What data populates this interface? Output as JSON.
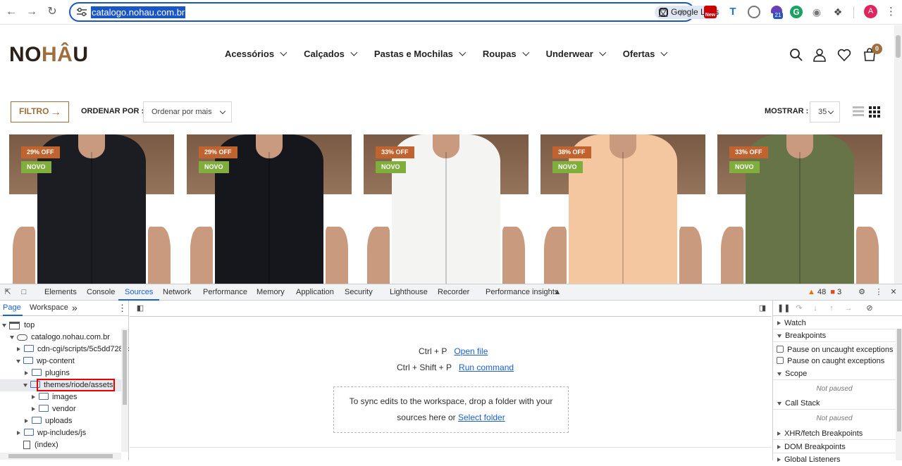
{
  "browser": {
    "url": "catalogo.nohau.com.br",
    "lens_label": "Google Lens",
    "ext_new_label": "New",
    "ext_21_label": "21",
    "avatar_letter": "A"
  },
  "site": {
    "logo_left": "NO",
    "logo_accent": "HÂ",
    "logo_right": "U",
    "menu": [
      {
        "label": "Acessórios"
      },
      {
        "label": "Calçados"
      },
      {
        "label": "Pastas e Mochilas"
      },
      {
        "label": "Roupas"
      },
      {
        "label": "Underwear"
      },
      {
        "label": "Ofertas"
      }
    ],
    "cart_count": "0"
  },
  "filters": {
    "filter_label": "FILTRO",
    "filter_arrow": "→",
    "order_label": "ORDENAR POR :",
    "order_value": "Ordenar por mais",
    "show_label": "MOSTRAR :",
    "show_value": "35"
  },
  "products": [
    {
      "discount": "29% OFF",
      "tag": "NOVO",
      "color": "#1b1d23"
    },
    {
      "discount": "29% OFF",
      "tag": "NOVO",
      "color": "#15171c"
    },
    {
      "discount": "33% OFF",
      "tag": "NOVO",
      "color": "#f4f4f2"
    },
    {
      "discount": "38% OFF",
      "tag": "NOVO",
      "color": "#f5c7a0"
    },
    {
      "discount": "33% OFF",
      "tag": "NOVO",
      "color": "#667448"
    }
  ],
  "devtools": {
    "tabs": [
      {
        "label": "Elements"
      },
      {
        "label": "Console"
      },
      {
        "label": "Sources"
      },
      {
        "label": "Network"
      },
      {
        "label": "Performance"
      },
      {
        "label": "Memory"
      },
      {
        "label": "Application"
      },
      {
        "label": "Security"
      },
      {
        "label": "Lighthouse"
      },
      {
        "label": "Recorder"
      },
      {
        "label": "Performance insights"
      }
    ],
    "active_tab": "Sources",
    "warnings": "48",
    "issues": "3",
    "left_tabs": {
      "page": "Page",
      "workspace": "Workspace",
      "more": "»"
    },
    "tree": [
      {
        "label": "top"
      },
      {
        "label": "catalogo.nohau.com.br"
      },
      {
        "label": "cdn-cgi/scripts/5c5dd728/c"
      },
      {
        "label": "wp-content"
      },
      {
        "label": "plugins"
      },
      {
        "label": "themes/riode/assets"
      },
      {
        "label": "images"
      },
      {
        "label": "vendor"
      },
      {
        "label": "uploads"
      },
      {
        "label": "wp-includes/js"
      },
      {
        "label": "(index)"
      }
    ],
    "shortcuts": [
      {
        "keys": "Ctrl + P",
        "action": "Open file"
      },
      {
        "keys": "Ctrl + Shift + P",
        "action": "Run command"
      }
    ],
    "drop_text_1": "To sync edits to the workspace, drop a folder with your",
    "drop_text_2": "sources here or",
    "drop_link": "Select folder",
    "right": {
      "watch": "Watch",
      "breakpoints": "Breakpoints",
      "pause_uncaught": "Pause on uncaught exceptions",
      "pause_caught": "Pause on caught exceptions",
      "scope": "Scope",
      "scope_status": "Not paused",
      "call_stack": "Call Stack",
      "call_stack_status": "Not paused",
      "xhr": "XHR/fetch Breakpoints",
      "dom": "DOM Breakpoints",
      "global": "Global Listeners"
    }
  }
}
